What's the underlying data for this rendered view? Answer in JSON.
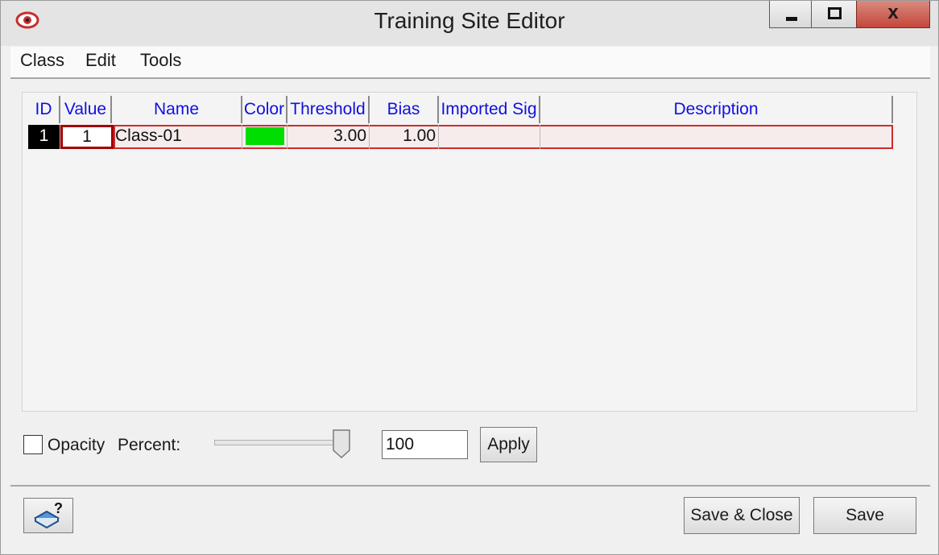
{
  "window": {
    "title": "Training Site Editor",
    "close_label": "x"
  },
  "menu": [
    "Class",
    "Edit",
    "Tools"
  ],
  "grid": {
    "columns": [
      "ID",
      "Value",
      "Name",
      "Color",
      "Threshold",
      "Bias",
      "Imported Sig",
      "Description"
    ],
    "rows": [
      {
        "id": "1",
        "value": "1",
        "name": "Class-01",
        "color": "#00dd00",
        "threshold": "3.00",
        "bias": "1.00",
        "imported_sig": "",
        "description": ""
      }
    ]
  },
  "opacity": {
    "checkbox_label": "Opacity",
    "checked": false,
    "percent_label": "Percent:",
    "slider_value": 100,
    "input_value": "100",
    "apply_label": "Apply"
  },
  "footer": {
    "help_icon": "book-help-icon",
    "save_close_label": "Save & Close",
    "save_label": "Save"
  }
}
